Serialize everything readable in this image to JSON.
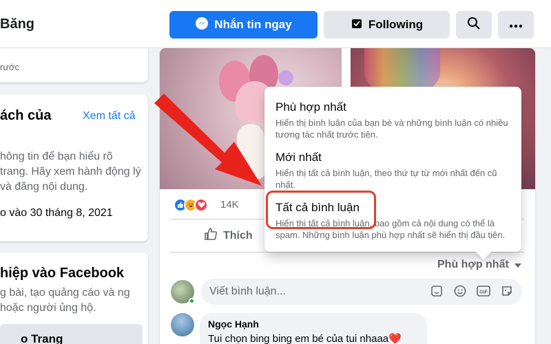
{
  "header": {
    "page_name": "Băng",
    "message_button": "Nhắn tin ngay",
    "following_button": "Following"
  },
  "left": {
    "card1_sub": "rước",
    "card2": {
      "title": "ách của",
      "see_all": "Xem tất cả",
      "desc": "hông tin để bạn hiểu rõ trang. Hãy xem hành động lý và đăng nội dung.",
      "date": "o vào 30 tháng 8, 2021"
    },
    "card3": {
      "title": "hiệp vào Facebook",
      "desc": "g bài, tạo quảng cáo và ng hoặc người ủng hộ.",
      "button": "o Trang"
    }
  },
  "post": {
    "reaction_count": "14K",
    "like_label": "Thích",
    "sort_label": "Phù hợp nhất",
    "comment_placeholder": "Viết bình luận...",
    "comment": {
      "name": "Ngọc Hạnh",
      "text": "Tui chọn bing bing em bé của tui nhaaa❤️"
    }
  },
  "dropdown": {
    "options": [
      {
        "title": "Phù hợp nhất",
        "desc": "Hiển thị bình luận của bạn bè và những bình luận có nhiều tương tác nhất trước tiên."
      },
      {
        "title": "Mới nhất",
        "desc": "Hiển thị tất cả bình luận, theo thứ tự từ mới nhất đến cũ nhất."
      },
      {
        "title": "Tất cả bình luận",
        "desc": "Hiển thị tất cả bình luận, bao gồm cả nội dung có thể là spam. Những bình luận phù hợp nhất sẽ hiển thị đầu tiên."
      }
    ]
  },
  "icons": {
    "messenger": "messenger-icon",
    "following": "following-icon",
    "search": "search-icon",
    "more": "more-icon",
    "like": "thumbs-up-icon",
    "sort_caret": "caret-down-icon",
    "sticker": "sticker-icon",
    "emoji": "emoji-icon",
    "gif": "gif-icon",
    "camera": "camera-icon"
  },
  "colors": {
    "accent": "#1877f2",
    "highlight": "#e0402d",
    "arrow": "#e8231b"
  }
}
